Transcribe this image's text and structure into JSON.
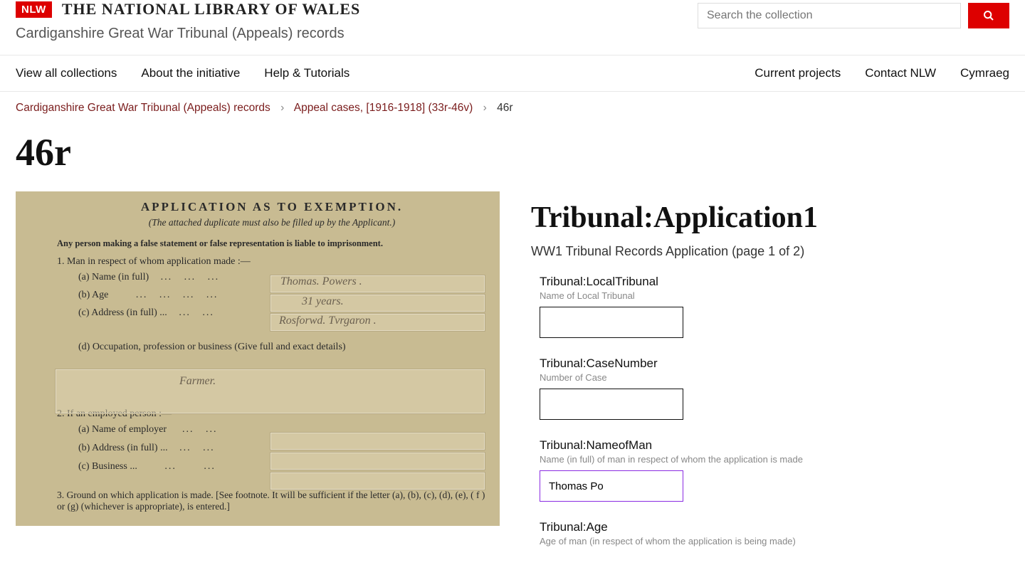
{
  "header": {
    "logo_text": "NLW",
    "site_title": "THE NATIONAL LIBRARY OF WALES",
    "collection_title": "Cardiganshire Great War Tribunal (Appeals) records",
    "search_placeholder": "Search the collection"
  },
  "nav": {
    "left": [
      "View all collections",
      "About the initiative",
      "Help & Tutorials"
    ],
    "right": [
      "Current projects",
      "Contact NLW",
      "Cymraeg"
    ]
  },
  "breadcrumb": {
    "items": [
      "Cardiganshire Great War Tribunal (Appeals) records",
      "Appeal cases, [1916-1918] (33r-46v)"
    ],
    "current": "46r"
  },
  "page_title": "46r",
  "document": {
    "heading": "APPLICATION AS TO EXEMPTION.",
    "subheading": "(The attached duplicate must also be filled up by the Applicant.)",
    "warning": "Any person making a false statement or false representation is liable to imprisonment.",
    "section1_head": "1. Man in respect of whom application made :—",
    "s1a": "(a) Name (in full)",
    "s1b": "(b) Age",
    "s1c": "(c) Address (in full) ...",
    "s1d": "(d) Occupation, profession or business (Give full and exact details)",
    "section2_head": "2. If an employed person :—",
    "s2a": "(a) Name of employer",
    "s2b": "(b) Address (in full) ...",
    "s2c": "(c) Business  ...",
    "section3": "3. Ground on which application is made.  [See footnote.  It will be sufficient if the letter (a), (b), (c), (d), (e), ( f ) or (g) (whichever is appropriate), is entered.]",
    "hand_name": "Thomas. Powers .",
    "hand_age": "31 years.",
    "hand_addr": "Rosforwd. Tvrgaron .",
    "hand_occ": "Farmer."
  },
  "form": {
    "title": "Tribunal:Application1",
    "subtitle": "WW1 Tribunal Records Application (page 1 of 2)",
    "fields": [
      {
        "label": "Tribunal:LocalTribunal",
        "help": "Name of Local Tribunal",
        "value": ""
      },
      {
        "label": "Tribunal:CaseNumber",
        "help": "Number of Case",
        "value": ""
      },
      {
        "label": "Tribunal:NameofMan",
        "help": "Name (in full) of man in respect of whom the application is made",
        "value": "Thomas Po"
      },
      {
        "label": "Tribunal:Age",
        "help": "Age of man (in respect of whom the application is being made)",
        "value": ""
      }
    ]
  }
}
